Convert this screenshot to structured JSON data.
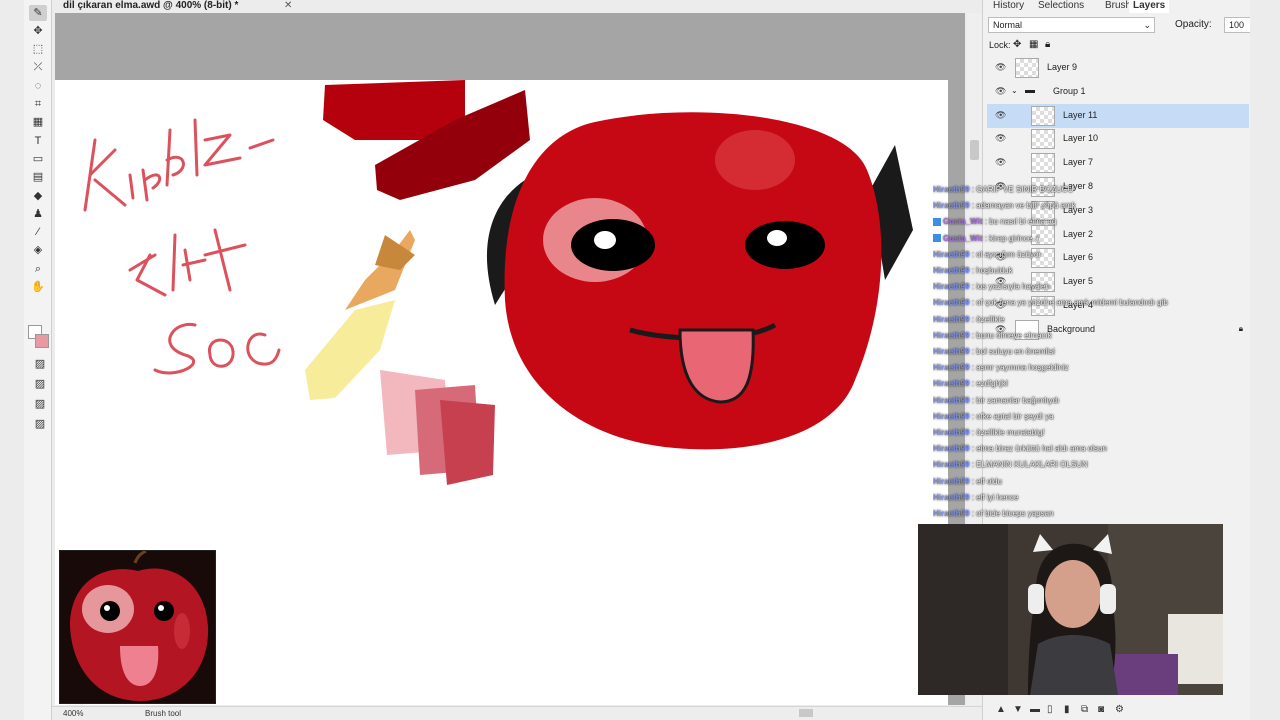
{
  "document": {
    "title": "dil çıkaran elma.awd @ 400% (8-bit) *",
    "close_glyph": "✕"
  },
  "canvas_text": {
    "handwriting": "Kirpi Elf Soc"
  },
  "tools": [
    {
      "name": "brush",
      "glyph": "✎",
      "active": true
    },
    {
      "name": "move",
      "glyph": "✥"
    },
    {
      "name": "rect-select",
      "glyph": "⬚"
    },
    {
      "name": "magic-wand",
      "glyph": "⤫"
    },
    {
      "name": "lasso",
      "glyph": "◌"
    },
    {
      "name": "crop",
      "glyph": "⌗"
    },
    {
      "name": "grid",
      "glyph": "▦"
    },
    {
      "name": "text",
      "glyph": "T"
    },
    {
      "name": "shape",
      "glyph": "▭"
    },
    {
      "name": "gradient",
      "glyph": "▤"
    },
    {
      "name": "eraser",
      "glyph": "◆"
    },
    {
      "name": "stamp",
      "glyph": "♟"
    },
    {
      "name": "eyedropper",
      "glyph": "⁄"
    },
    {
      "name": "bucket",
      "glyph": "◈"
    },
    {
      "name": "zoom",
      "glyph": "⌕"
    },
    {
      "name": "hand",
      "glyph": "✋"
    }
  ],
  "colors": {
    "primary": "#ffffff",
    "secondary": "#e89aa3",
    "selection": "#c6dcf6"
  },
  "status": {
    "zoom": "400%",
    "tool": "Brush tool"
  },
  "panel": {
    "tabs": [
      "History",
      "Selections",
      "Brush",
      "Layers"
    ],
    "active_tab": "Layers",
    "blend_mode": "Normal",
    "opacity_label": "Opacity:",
    "opacity_value": "100",
    "lock_label": "Lock:",
    "layers": [
      {
        "name": "Layer 9",
        "indent": 0,
        "visible": true
      },
      {
        "name": "Group 1",
        "indent": 0,
        "visible": true,
        "group": true
      },
      {
        "name": "Layer 11",
        "indent": 1,
        "visible": true,
        "selected": true
      },
      {
        "name": "Layer 10",
        "indent": 1,
        "visible": true
      },
      {
        "name": "Layer 7",
        "indent": 1,
        "visible": true
      },
      {
        "name": "Layer 8",
        "indent": 1,
        "visible": true
      },
      {
        "name": "Layer 3",
        "indent": 1,
        "visible": false
      },
      {
        "name": "Layer 2",
        "indent": 1,
        "visible": false
      },
      {
        "name": "Layer 6",
        "indent": 1,
        "visible": true
      },
      {
        "name": "Layer 5",
        "indent": 1,
        "visible": true
      },
      {
        "name": "Layer 4",
        "indent": 1,
        "visible": true
      },
      {
        "name": "Background",
        "indent": 0,
        "visible": true,
        "locked": true
      }
    ]
  },
  "chat": [
    {
      "user": "Hiraeth99",
      "msg": "GARIP VE SINIR BOZUCU"
    },
    {
      "user": "Hiraeth99",
      "msg": "adamayan ve bilir çöpü amk"
    },
    {
      "user": "Gusta_Wit",
      "msg": "bu nasıl bi elma aq",
      "color": "purple",
      "badge": true
    },
    {
      "user": "Gusta_Wit",
      "msg": "kirap girince :(",
      "color": "purple",
      "badge": true
    },
    {
      "user": "Hiraeth99",
      "msg": "ol ayıcığım üzüyor"
    },
    {
      "user": "Hiraeth99",
      "msg": "hoşbulduk"
    },
    {
      "user": "Hiraeth99",
      "msg": "ios yazısıyla hayalen"
    },
    {
      "user": "Hiraeth99",
      "msg": "of çok fena ya yüzüne ama amk midemi bulandırdı gib"
    },
    {
      "user": "Hiraeth99",
      "msg": "özellikle"
    },
    {
      "user": "Hiraeth99",
      "msg": "bunu ölmeye elmacık"
    },
    {
      "user": "Hiraeth99",
      "msg": "bol suluyu en önemlisi"
    },
    {
      "user": "Hiraeth99",
      "msg": "asmr yayınına hoşgeldiniz"
    },
    {
      "user": "Hiraeth99",
      "msg": "ezdfghjkl"
    },
    {
      "user": "Hiraeth99",
      "msg": "bir zamanlar bağımlıydı"
    },
    {
      "user": "Hiraeth99",
      "msg": "ofke aptal bir şeydi ya"
    },
    {
      "user": "Hiraeth99",
      "msg": "özellikle muratabig!"
    },
    {
      "user": "Hiraeth99",
      "msg": "elma biraz ürküttü hal aldı ama olsun"
    },
    {
      "user": "Hiraeth99",
      "msg": "ELMANIN KULAKLARI OLSUN"
    },
    {
      "user": "Hiraeth99",
      "msg": "elf oldu"
    },
    {
      "user": "Hiraeth99",
      "msg": "elf iyi hence"
    },
    {
      "user": "Hiraeth99",
      "msg": "of bide biceps yapsan"
    }
  ]
}
